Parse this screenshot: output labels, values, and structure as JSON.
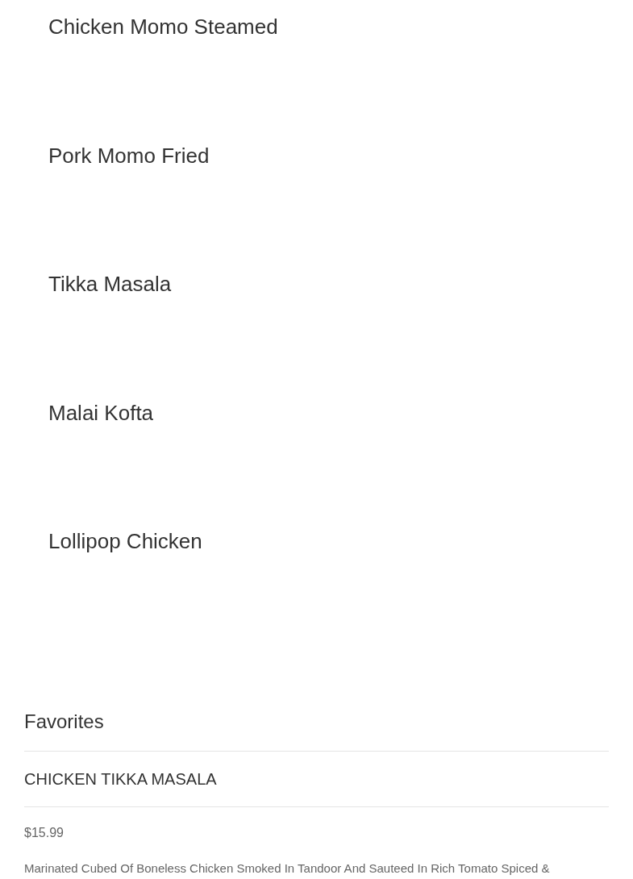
{
  "menu_items": [
    {
      "name": "Chicken Momo Steamed"
    },
    {
      "name": "Pork Momo Fried"
    },
    {
      "name": "Tikka Masala"
    },
    {
      "name": "Malai Kofta"
    },
    {
      "name": "Lollipop Chicken"
    }
  ],
  "favorites": {
    "title": "Favorites",
    "item": {
      "name": "CHICKEN TIKKA MASALA",
      "price": "$15.99",
      "description": "Marinated Cubed Of Boneless Chicken Smoked In Tandoor And Sauteed In Rich Tomato Spiced &"
    }
  }
}
